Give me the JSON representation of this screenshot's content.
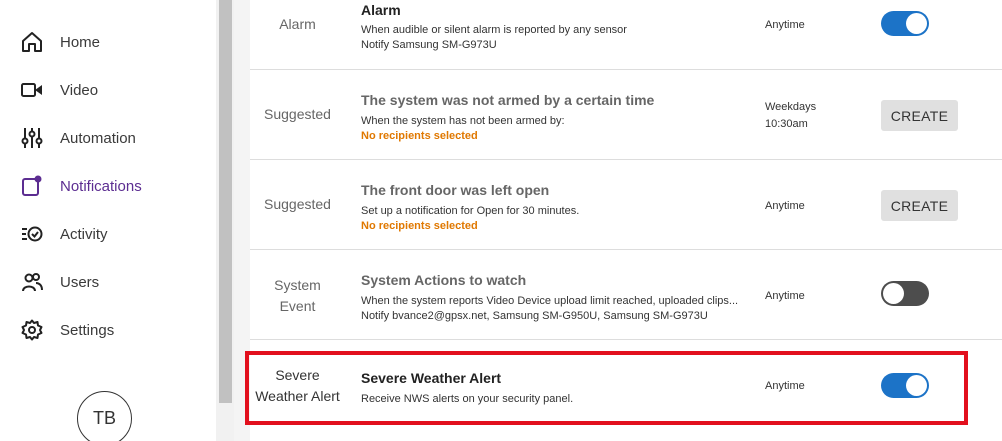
{
  "sidebar": {
    "items": [
      {
        "label": "Home",
        "icon": "home-icon",
        "active": false
      },
      {
        "label": "Video",
        "icon": "video-icon",
        "active": false
      },
      {
        "label": "Automation",
        "icon": "sliders-icon",
        "active": false
      },
      {
        "label": "Notifications",
        "icon": "notification-icon",
        "active": true
      },
      {
        "label": "Activity",
        "icon": "activity-icon",
        "active": false
      },
      {
        "label": "Users",
        "icon": "users-icon",
        "active": false
      },
      {
        "label": "Settings",
        "icon": "gear-icon",
        "active": false
      }
    ],
    "avatar_initials": "TB"
  },
  "colors": {
    "accent_purple": "#5c2d91",
    "toggle_on": "#1c73c7",
    "toggle_off": "#4d4d4d",
    "warning_orange": "#e07800",
    "highlight_red": "#e2101d"
  },
  "notifications": [
    {
      "type": "Alarm",
      "title": "Alarm",
      "desc": "When audible or silent alarm is reported by any sensor",
      "recipients": "Notify Samsung SM-G973U",
      "schedule": "Anytime",
      "action": "toggle",
      "enabled": true
    },
    {
      "type": "Suggested",
      "title": "The system was not armed by a certain time",
      "desc": "When the system has not been armed by:",
      "warning": "No recipients selected",
      "schedule_line1": "Weekdays",
      "schedule_line2": "10:30am",
      "action": "create",
      "action_label": "CREATE"
    },
    {
      "type": "Suggested",
      "title": "The front door was left open",
      "desc": "Set up a notification for Open for 30 minutes.",
      "warning": "No recipients selected",
      "schedule": "Anytime",
      "action": "create",
      "action_label": "CREATE"
    },
    {
      "type_line1": "System",
      "type_line2": "Event",
      "title": "System Actions to watch",
      "desc": "When the system reports Video Device upload limit reached, uploaded clips...",
      "recipients": "Notify bvance2@gpsx.net, Samsung SM-G950U, Samsung SM-G973U",
      "schedule": "Anytime",
      "action": "toggle",
      "enabled": false
    },
    {
      "type_line1": "Severe",
      "type_line2": "Weather Alert",
      "title": "Severe Weather Alert",
      "desc": "Receive NWS alerts on your security panel.",
      "schedule": "Anytime",
      "action": "toggle",
      "enabled": true
    }
  ]
}
